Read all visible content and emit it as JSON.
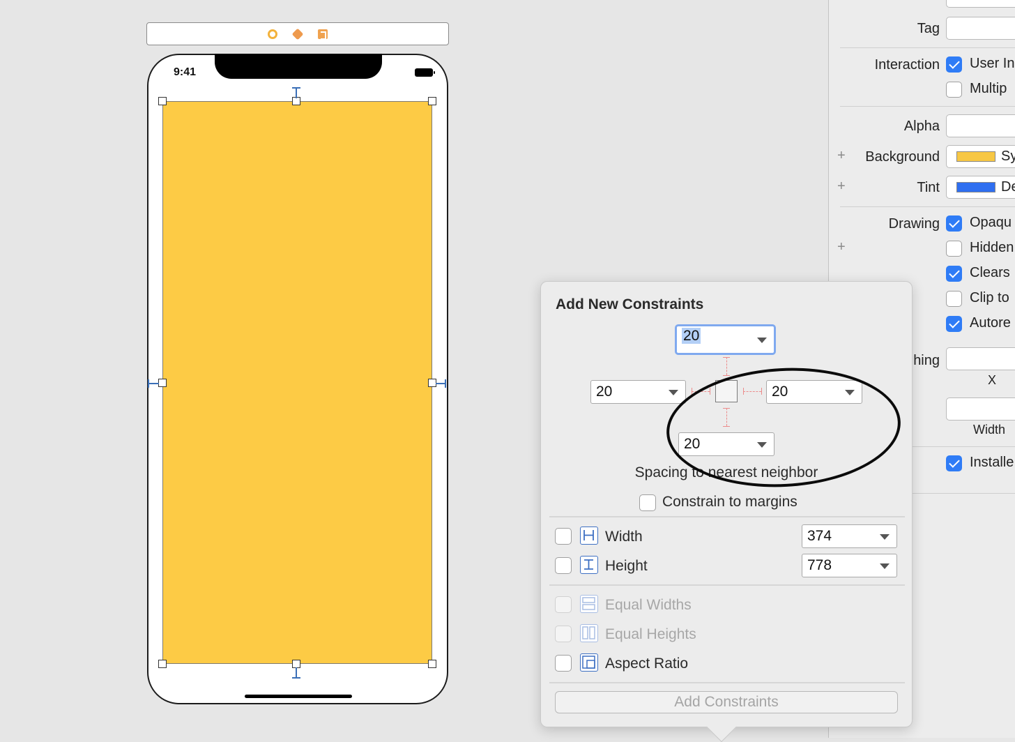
{
  "device": {
    "status_time": "9:41"
  },
  "inspector": {
    "rows": {
      "tag_label": "Tag",
      "interaction_label": "Interaction",
      "user_interaction": "User In",
      "multiple_touch": "Multip",
      "alpha_label": "Alpha",
      "background_label": "Background",
      "background_value": "Sy",
      "background_color": "#f7c744",
      "tint_label": "Tint",
      "tint_value": "De",
      "tint_color": "#2f6ff0",
      "drawing_label": "Drawing",
      "opaque": "Opaqu",
      "hidden": "Hidden",
      "clears": "Clears",
      "clip": "Clip to",
      "autoresize": "Autore",
      "stretching_label": "hing",
      "x_label": "X",
      "width_label": "Width",
      "installed": "Installe",
      "plus": "+"
    }
  },
  "popover": {
    "title": "Add New Constraints",
    "top_value": "20",
    "left_value": "20",
    "right_value": "20",
    "bottom_value": "20",
    "caption": "Spacing to nearest neighbor",
    "constrain_margins": "Constrain to margins",
    "width_label": "Width",
    "width_value": "374",
    "height_label": "Height",
    "height_value": "778",
    "equal_widths": "Equal Widths",
    "equal_heights": "Equal Heights",
    "aspect_ratio": "Aspect Ratio",
    "add_button": "Add Constraints"
  },
  "colors": {
    "view_fill": "#fdcb45",
    "check_accent": "#2f7cf6"
  }
}
